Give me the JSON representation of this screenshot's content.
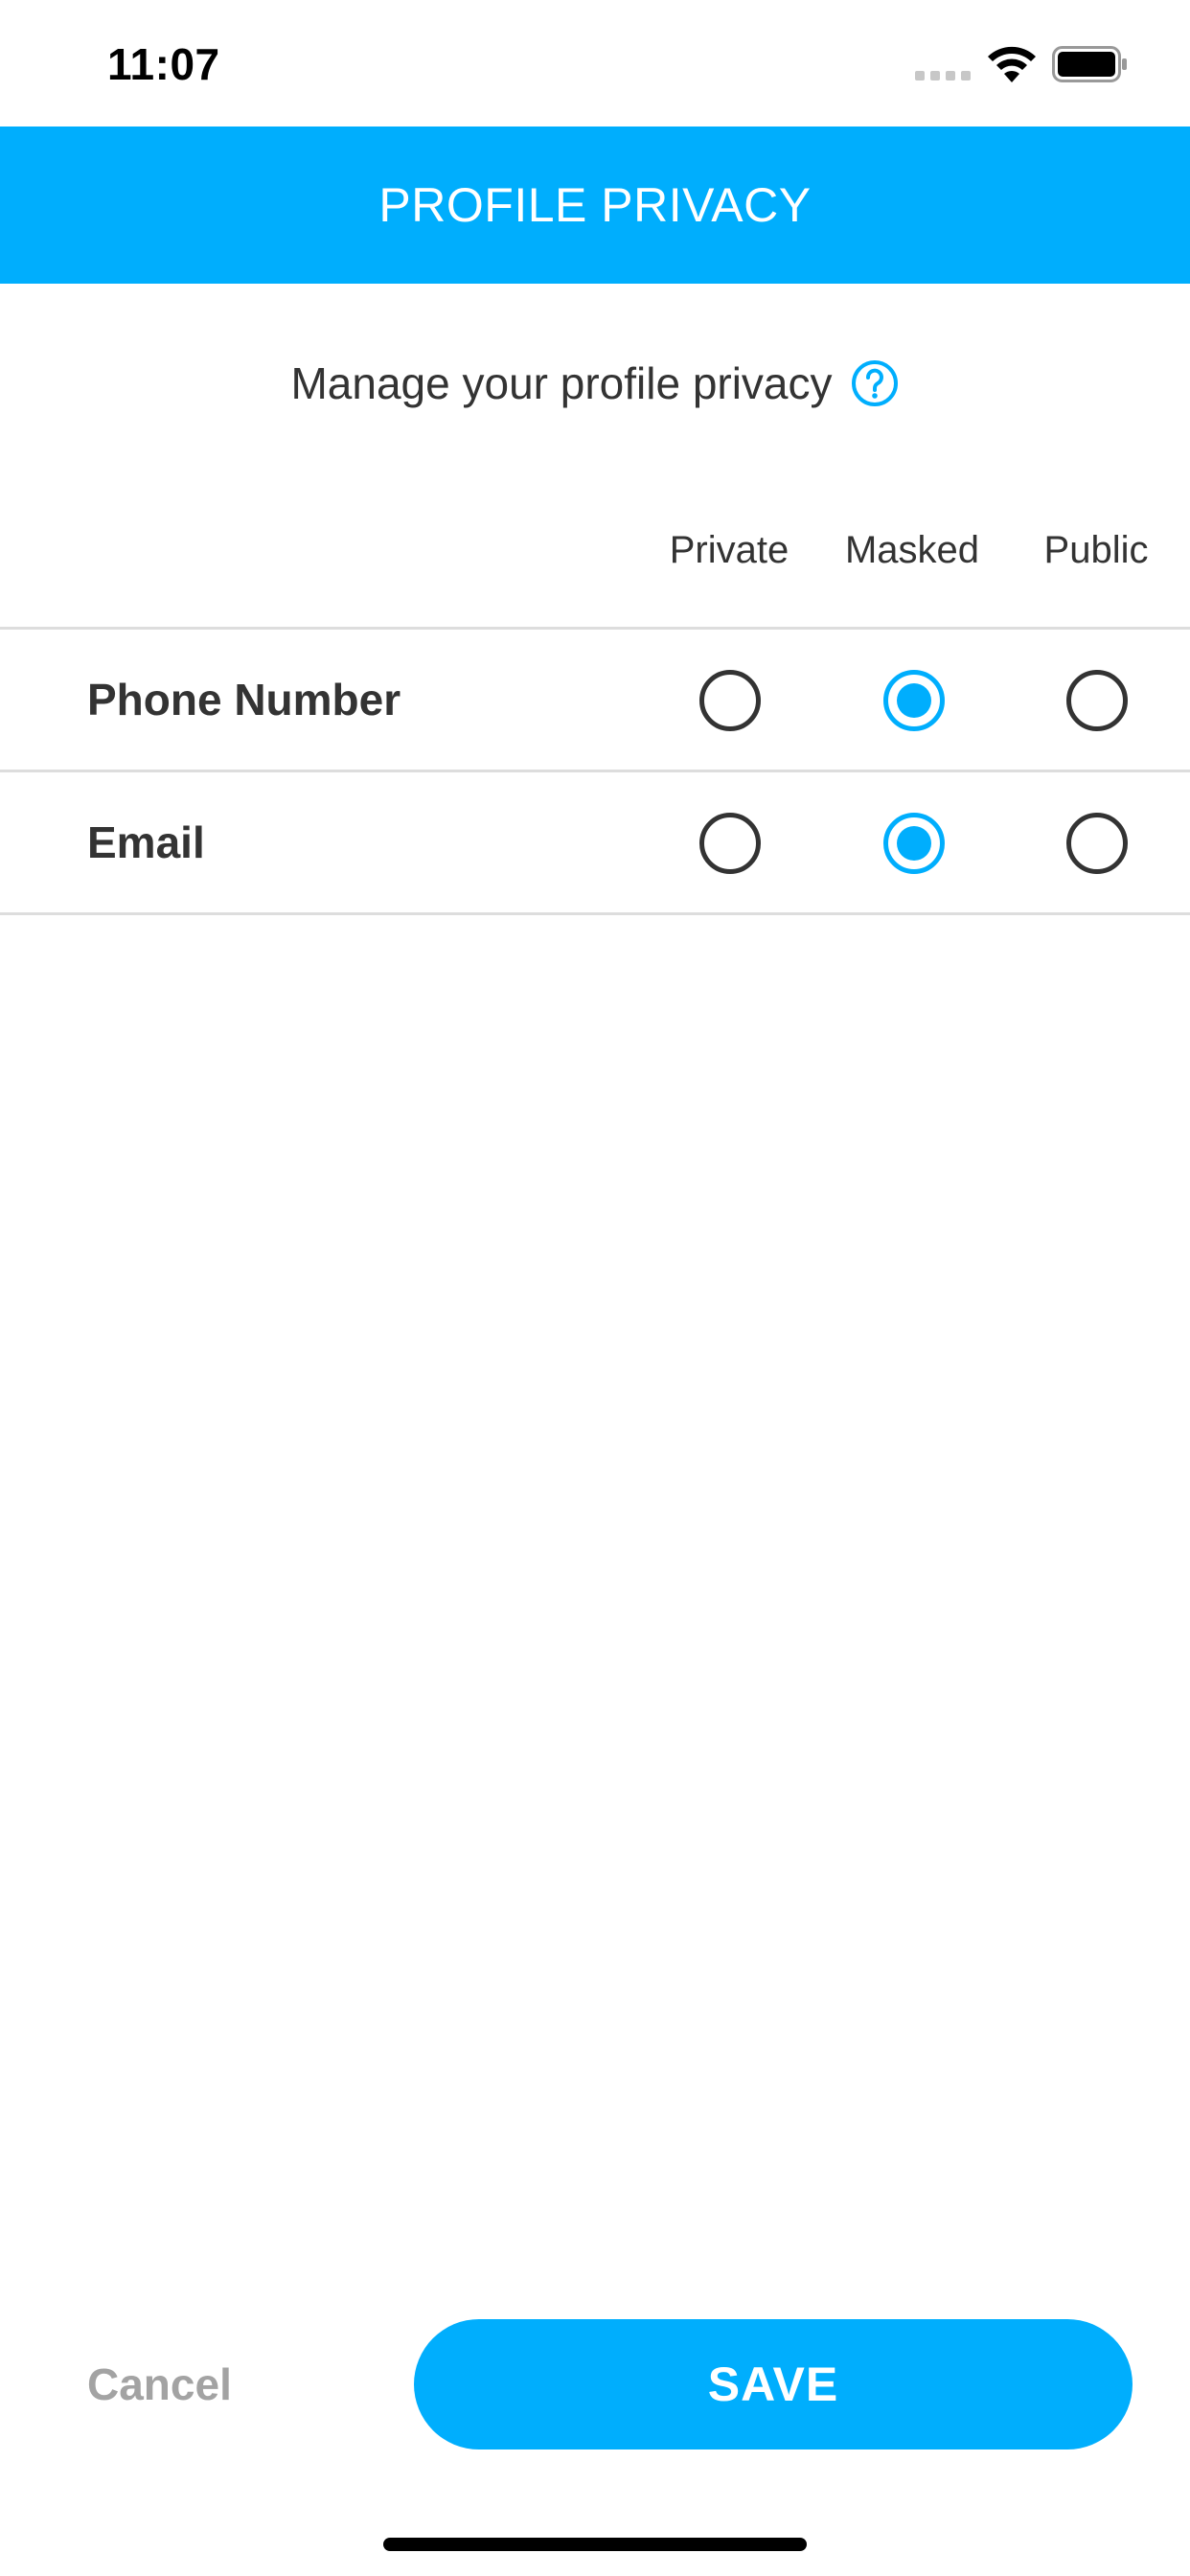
{
  "status_bar": {
    "time": "11:07",
    "icons": [
      "signal-dots-icon",
      "wifi-icon",
      "battery-icon"
    ]
  },
  "header": {
    "title": "PROFILE PRIVACY",
    "background_color": "#00aefd"
  },
  "subtitle": {
    "text": "Manage your profile privacy",
    "help_icon": "help-icon",
    "help_icon_color": "#00aefd"
  },
  "columns": [
    "Private",
    "Masked",
    "Public"
  ],
  "rows": [
    {
      "label": "Phone Number",
      "selected": "Masked"
    },
    {
      "label": "Email",
      "selected": "Masked"
    }
  ],
  "footer": {
    "cancel_label": "Cancel",
    "save_label": "SAVE"
  },
  "colors": {
    "accent": "#00aefd",
    "text": "#333333",
    "muted": "#a3a3a3",
    "divider": "#dddddd"
  }
}
